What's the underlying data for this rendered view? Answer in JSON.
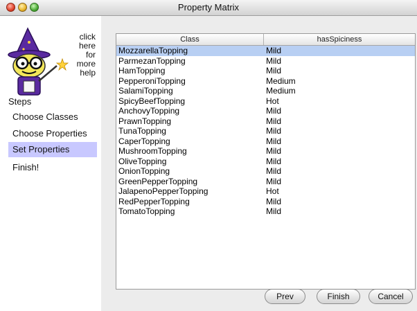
{
  "window": {
    "title": "Property Matrix"
  },
  "sidebar": {
    "help_lines": [
      "click",
      "here",
      "for",
      "more",
      "help"
    ],
    "steps_label": "Steps",
    "steps": [
      {
        "label": "Choose Classes",
        "active": false
      },
      {
        "label": "Choose Properties",
        "active": false
      },
      {
        "label": "Set Properties",
        "active": true
      },
      {
        "label": "Finish!",
        "active": false
      }
    ]
  },
  "table": {
    "columns": [
      "Class",
      "hasSpiciness"
    ],
    "rows": [
      [
        "MozzarellaTopping",
        "Mild"
      ],
      [
        "ParmezanTopping",
        "Mild"
      ],
      [
        "HamTopping",
        "Mild"
      ],
      [
        "PepperoniTopping",
        "Medium"
      ],
      [
        "SalamiTopping",
        "Medium"
      ],
      [
        "SpicyBeefTopping",
        "Hot"
      ],
      [
        "AnchovyTopping",
        "Mild"
      ],
      [
        "PrawnTopping",
        "Mild"
      ],
      [
        "TunaTopping",
        "Mild"
      ],
      [
        "CaperTopping",
        "Mild"
      ],
      [
        "MushroomTopping",
        "Mild"
      ],
      [
        "OliveTopping",
        "Mild"
      ],
      [
        "OnionTopping",
        "Mild"
      ],
      [
        "GreenPepperTopping",
        "Mild"
      ],
      [
        "JalapenoPepperTopping",
        "Hot"
      ],
      [
        "RedPepperTopping",
        "Mild"
      ],
      [
        "TomatoTopping",
        "Mild"
      ]
    ],
    "selected_row": 0
  },
  "buttons": {
    "prev": "Prev",
    "finish": "Finish",
    "cancel": "Cancel"
  },
  "colors": {
    "selected_step": "#c8c8ff",
    "selected_row": "#b8cff3"
  }
}
